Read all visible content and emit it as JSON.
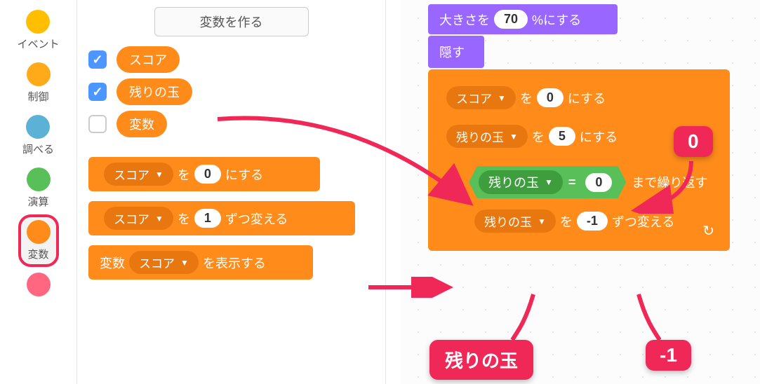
{
  "categories": [
    {
      "label": "イベント",
      "color": "#ffbf00"
    },
    {
      "label": "制御",
      "color": "#ffab19"
    },
    {
      "label": "調べる",
      "color": "#5cb1d6"
    },
    {
      "label": "演算",
      "color": "#59c059"
    },
    {
      "label": "変数",
      "color": "#ff8c1a",
      "selected": true
    },
    {
      "label": "",
      "color": "#ff6680"
    }
  ],
  "palette": {
    "make_var": "変数を作る",
    "vars": [
      {
        "checked": true,
        "name": "スコア"
      },
      {
        "checked": true,
        "name": "残りの玉"
      },
      {
        "checked": false,
        "name": "変数"
      }
    ],
    "set_block": {
      "dd": "スコア",
      "mid": "を",
      "val": "0",
      "tail": "にする"
    },
    "change_block": {
      "dd": "スコア",
      "mid": "を",
      "val": "1",
      "tail": "ずつ変える"
    },
    "show_block": {
      "pre": "変数",
      "dd": "スコア",
      "tail": "を表示する"
    }
  },
  "script": {
    "size": {
      "pre": "大きさを",
      "val": "70",
      "tail": "%にする"
    },
    "hide": "隠す",
    "set_score": {
      "dd": "スコア",
      "mid": "を",
      "val": "0",
      "tail": "にする"
    },
    "set_balls": {
      "dd": "残りの玉",
      "mid": "を",
      "val": "5",
      "tail": "にする"
    },
    "repeat": {
      "eq_left": "残りの玉",
      "eq_op": "=",
      "eq_right": "0",
      "tail": "まで繰り返す"
    },
    "change_balls": {
      "dd": "残りの玉",
      "mid": "を",
      "val": "-1",
      "tail": "ずつ変える"
    }
  },
  "callouts": {
    "zero": "0",
    "balls": "残りの玉",
    "neg1": "-1"
  }
}
